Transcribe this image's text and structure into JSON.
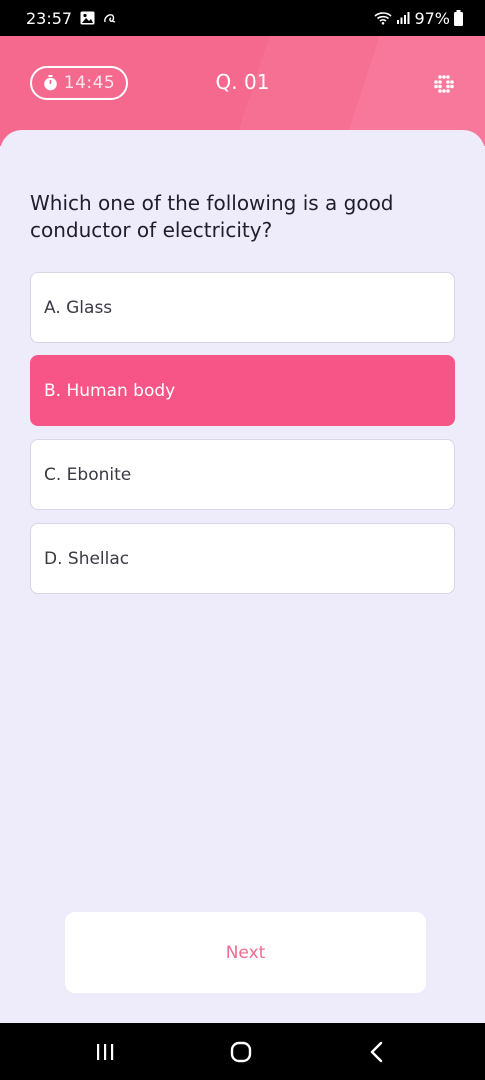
{
  "status_bar": {
    "time": "23:57",
    "battery": "97%",
    "icons": [
      "gallery-icon",
      "assistant-icon",
      "wifi-icon",
      "signal-icon",
      "battery-icon"
    ]
  },
  "header": {
    "timer": "14:45",
    "question_number": "Q. 01",
    "timer_icon": "stopwatch-icon",
    "menu_icon": "grid-dots-icon",
    "color": "#f6698f"
  },
  "question": {
    "text": "Which one of the following is a good conductor of electricity?"
  },
  "options": [
    {
      "label": "A. Glass",
      "selected": false
    },
    {
      "label": "B. Human body",
      "selected": true
    },
    {
      "label": "C. Ebonite",
      "selected": false
    },
    {
      "label": "D. Shellac",
      "selected": false
    }
  ],
  "next": {
    "label": "Next"
  },
  "nav_bar": {
    "icons": [
      "recent-apps-icon",
      "home-icon",
      "back-icon"
    ]
  },
  "colors": {
    "accent": "#f75487",
    "background": "#eeebfb"
  }
}
